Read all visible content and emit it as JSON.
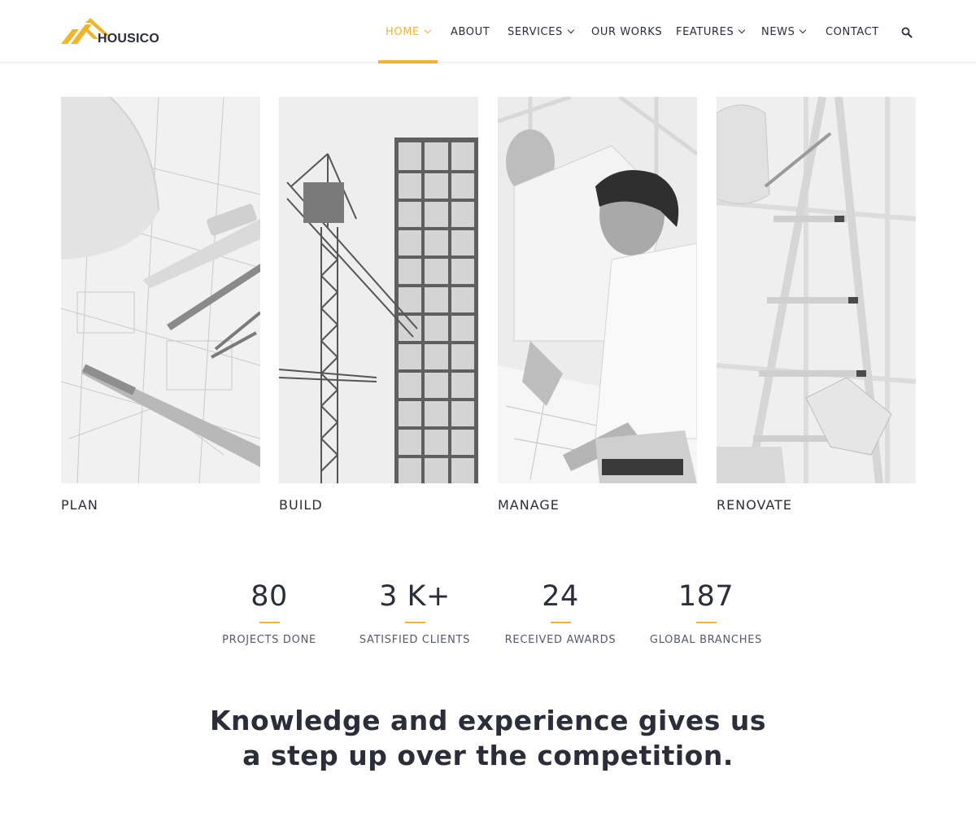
{
  "brand": {
    "name": "HOUSICO",
    "accent_color": "#f0b52c",
    "text_color": "#2b2e39"
  },
  "nav": {
    "items": [
      {
        "label": "HOME",
        "dropdown": true,
        "active": true
      },
      {
        "label": "ABOUT",
        "dropdown": false
      },
      {
        "label": "SERVICES",
        "dropdown": true
      },
      {
        "label": "OUR WORKS",
        "dropdown": false
      },
      {
        "label": "FEATURES",
        "dropdown": true
      },
      {
        "label": "NEWS",
        "dropdown": true
      },
      {
        "label": "CONTACT",
        "dropdown": false
      }
    ],
    "search_icon": "search-icon"
  },
  "services": [
    {
      "title": "PLAN",
      "image": "blueprints-pen-hardhat-photo"
    },
    {
      "title": "BUILD",
      "image": "construction-crane-building-photo"
    },
    {
      "title": "MANAGE",
      "image": "engineers-reviewing-plans-photo"
    },
    {
      "title": "RENOVATE",
      "image": "ladder-gloves-hardhat-photo"
    }
  ],
  "stats": [
    {
      "value": "80",
      "label": "PROJECTS DONE"
    },
    {
      "value": "3 K+",
      "label": "SATISFIED CLIENTS"
    },
    {
      "value": "24",
      "label": "RECEIVED AWARDS"
    },
    {
      "value": "187",
      "label": "GLOBAL BRANCHES"
    }
  ],
  "tagline": {
    "line1": "Knowledge and experience gives us",
    "line2": "a step up over the competition."
  }
}
